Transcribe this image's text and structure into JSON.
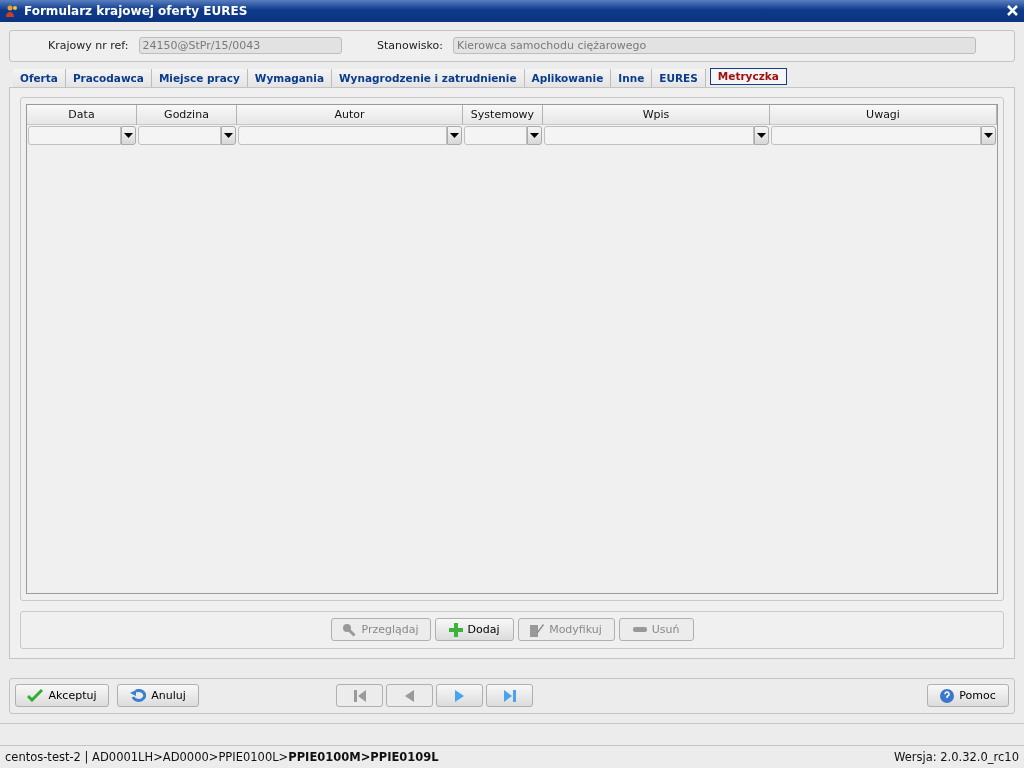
{
  "window": {
    "title": "Formularz krajowej oferty EURES"
  },
  "header": {
    "fields": [
      {
        "label": "Krajowy nr ref:",
        "value": "24150@StPr/15/0043",
        "disabled": true
      },
      {
        "label": "Stanowisko:",
        "value": "Kierowca samochodu ciężarowego",
        "disabled": true
      }
    ]
  },
  "tabs": [
    {
      "label": "Oferta",
      "selected": false
    },
    {
      "label": "Pracodawca",
      "selected": false
    },
    {
      "label": "Miejsce pracy",
      "selected": false
    },
    {
      "label": "Wymagania",
      "selected": false
    },
    {
      "label": "Wynagrodzenie i zatrudnienie",
      "selected": false
    },
    {
      "label": "Aplikowanie",
      "selected": false
    },
    {
      "label": "Inne",
      "selected": false
    },
    {
      "label": "EURES",
      "selected": false
    },
    {
      "label": "Metryczka",
      "selected": true
    }
  ],
  "table": {
    "columns": [
      "Data",
      "Godzina",
      "Autor",
      "Systemowy",
      "Wpis",
      "Uwagi"
    ]
  },
  "actions": [
    {
      "kind": "search",
      "label": "Przeglądaj",
      "disabled": true
    },
    {
      "kind": "add",
      "label": "Dodaj",
      "disabled": false
    },
    {
      "kind": "edit",
      "label": "Modyfikuj",
      "disabled": true
    },
    {
      "kind": "remove",
      "label": "Usuń",
      "disabled": true
    }
  ],
  "footer": {
    "left": [
      {
        "kind": "accept",
        "label": "Akceptuj"
      },
      {
        "kind": "cancel",
        "label": "Anuluj"
      }
    ],
    "navigation": [
      {
        "kind": "first",
        "disabled": true
      },
      {
        "kind": "prev",
        "disabled": true
      },
      {
        "kind": "next",
        "disabled": false
      },
      {
        "kind": "last",
        "disabled": false
      }
    ],
    "right": [
      {
        "kind": "help",
        "label": "Pomoc"
      }
    ]
  },
  "status_bar": {
    "path": "centos-test-2 | AD0001LH>AD0000>PPIE0100L>**PPIE0100M>PPIE0109L**",
    "version": "Wersja: 2.0.32.0_rc10"
  }
}
